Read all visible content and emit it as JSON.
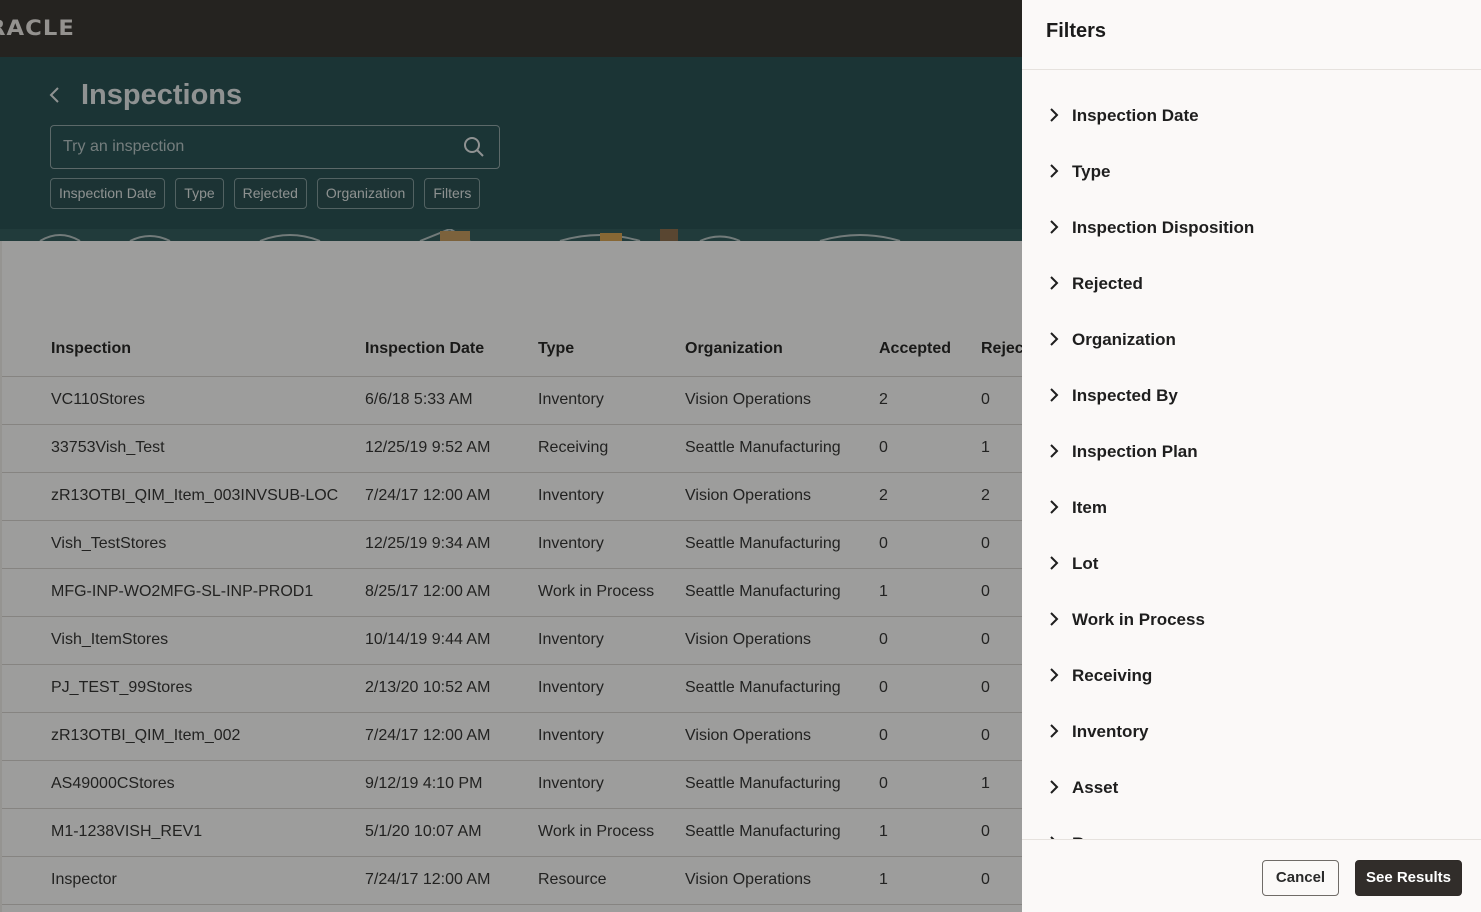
{
  "brand": {
    "logo_text": "RACLE"
  },
  "header": {
    "title": "Inspections"
  },
  "search": {
    "placeholder": "Try an inspection"
  },
  "chips": [
    "Inspection Date",
    "Type",
    "Rejected",
    "Organization",
    "Filters"
  ],
  "table": {
    "columns": [
      "Inspection",
      "Inspection Date",
      "Type",
      "Organization",
      "Accepted",
      "Rejec"
    ],
    "rows": [
      [
        "VC110Stores",
        "6/6/18 5:33 AM",
        "Inventory",
        "Vision Operations",
        "2",
        "0"
      ],
      [
        "33753Vish_Test",
        "12/25/19 9:52 AM",
        "Receiving",
        "Seattle Manufacturing",
        "0",
        "1"
      ],
      [
        "zR13OTBI_QIM_Item_003INVSUB-LOC",
        "7/24/17 12:00 AM",
        "Inventory",
        "Vision Operations",
        "2",
        "2"
      ],
      [
        "Vish_TestStores",
        "12/25/19 9:34 AM",
        "Inventory",
        "Seattle Manufacturing",
        "0",
        "0"
      ],
      [
        "MFG-INP-WO2MFG-SL-INP-PROD1",
        "8/25/17 12:00 AM",
        "Work in Process",
        "Seattle Manufacturing",
        "1",
        "0"
      ],
      [
        "Vish_ItemStores",
        "10/14/19 9:44 AM",
        "Inventory",
        "Vision Operations",
        "0",
        "0"
      ],
      [
        "PJ_TEST_99Stores",
        "2/13/20 10:52 AM",
        "Inventory",
        "Seattle Manufacturing",
        "0",
        "0"
      ],
      [
        "zR13OTBI_QIM_Item_002",
        "7/24/17 12:00 AM",
        "Inventory",
        "Vision Operations",
        "0",
        "0"
      ],
      [
        "AS49000CStores",
        "9/12/19 4:10 PM",
        "Inventory",
        "Seattle Manufacturing",
        "0",
        "1"
      ],
      [
        "M1-1238VISH_REV1",
        "5/1/20 10:07 AM",
        "Work in Process",
        "Seattle Manufacturing",
        "1",
        "0"
      ],
      [
        "Inspector",
        "7/24/17 12:00 AM",
        "Resource",
        "Vision Operations",
        "1",
        "0"
      ]
    ]
  },
  "drawer": {
    "title": "Filters",
    "items": [
      "Inspection Date",
      "Type",
      "Inspection Disposition",
      "Rejected",
      "Organization",
      "Inspected By",
      "Inspection Plan",
      "Item",
      "Lot",
      "Work in Process",
      "Receiving",
      "Inventory",
      "Asset",
      "Resource"
    ],
    "cancel_label": "Cancel",
    "results_label": "See Results"
  },
  "colors": {
    "topbar": "#312d2a",
    "hero": "#1f4a4e",
    "drawer": "#fbf9f8",
    "primary_button": "#312d2a"
  }
}
